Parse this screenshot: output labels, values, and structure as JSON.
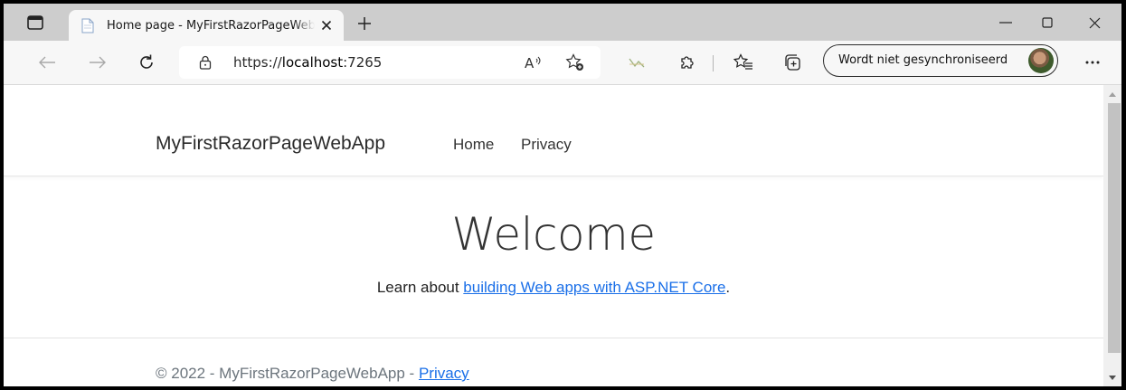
{
  "browser": {
    "tab": {
      "title": "Home page - MyFirstRazorPageWebApp",
      "close_icon": "close-icon",
      "favicon": "page-icon"
    },
    "new_tab_icon": "plus-icon",
    "window_controls": [
      "minimize-icon",
      "maximize-icon",
      "close-icon"
    ],
    "toolbar": {
      "back_icon": "arrow-left-icon",
      "forward_icon": "arrow-right-icon",
      "refresh_icon": "refresh-icon",
      "lock_icon": "lock-icon",
      "url_prefix": "https://",
      "url_host": "localhost",
      "url_port": ":7265",
      "read_aloud_icon": "read-aloud-icon",
      "add_favorite_icon": "add-favorite-icon",
      "extension_icon": "extension-icon",
      "extensions_icon": "puzzle-icon",
      "favorites_icon": "favorites-icon",
      "collections_icon": "collections-icon",
      "profile_label": "Wordt niet gesynchroniseerd",
      "more_icon": "more-icon"
    }
  },
  "site": {
    "brand": "MyFirstRazorPageWebApp",
    "nav": [
      "Home",
      "Privacy"
    ],
    "heading": "Welcome",
    "intro_prefix": "Learn about ",
    "intro_link": "building Web apps with ASP.NET Core",
    "intro_suffix": ".",
    "footer_text": "© 2022 - MyFirstRazorPageWebApp - ",
    "footer_link": "Privacy"
  },
  "colors": {
    "link": "#1a6fe8",
    "tabstrip": "#cdcdcd",
    "toolbar": "#f7f7f7"
  }
}
